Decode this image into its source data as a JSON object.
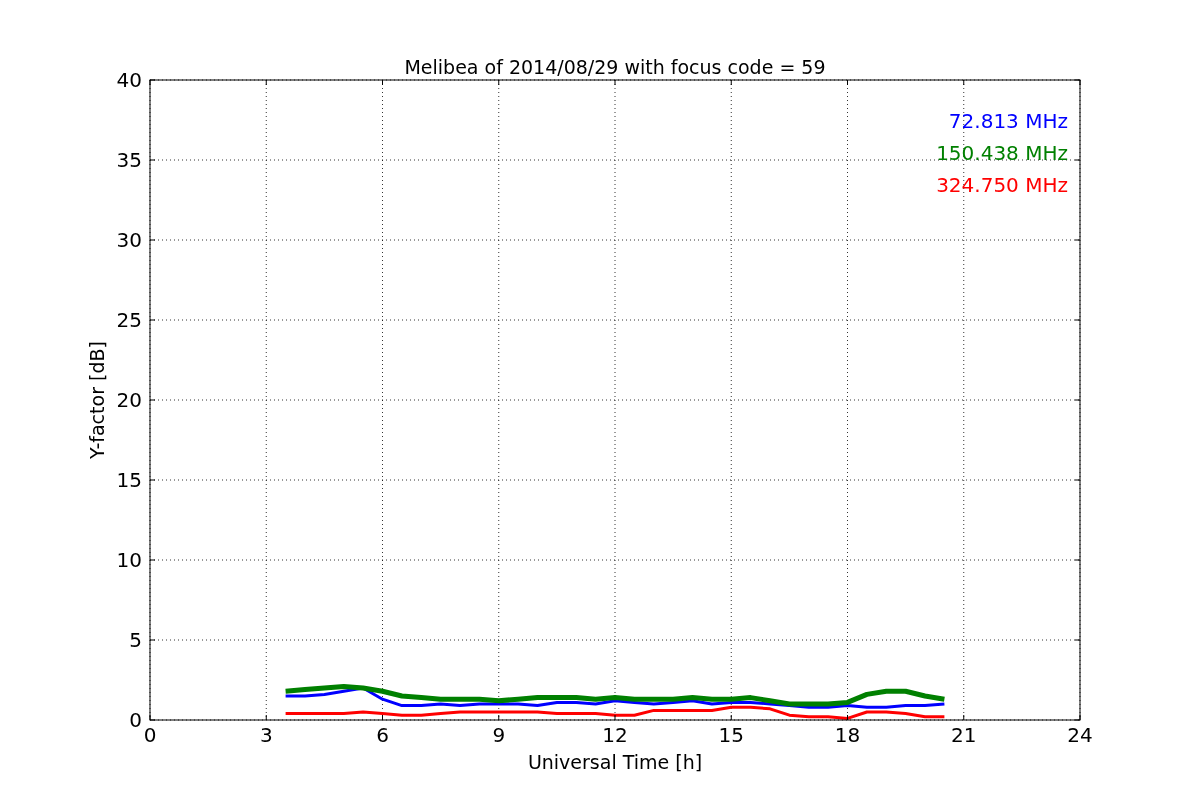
{
  "chart_data": {
    "type": "line",
    "title": "Melibea of 2014/08/29 with focus code = 59",
    "xlabel": "Universal Time [h]",
    "ylabel": "Y-factor [dB]",
    "x": [
      3.5,
      4,
      4.5,
      5,
      5.5,
      6,
      6.5,
      7,
      7.5,
      8,
      8.5,
      9,
      9.5,
      10,
      10.5,
      11,
      11.5,
      12,
      12.5,
      13,
      13.5,
      14,
      14.5,
      15,
      15.5,
      16,
      16.5,
      17,
      17.5,
      18,
      18.5,
      19,
      19.5,
      20,
      20.5
    ],
    "series": [
      {
        "name": "72.813 MHz",
        "color": "#0000ff",
        "values": [
          1.5,
          1.5,
          1.6,
          1.8,
          2.0,
          1.3,
          0.9,
          0.9,
          1.0,
          0.9,
          1.0,
          1.0,
          1.0,
          0.9,
          1.1,
          1.1,
          1.0,
          1.2,
          1.1,
          1.0,
          1.1,
          1.2,
          1.0,
          1.1,
          1.1,
          1.0,
          0.9,
          0.8,
          0.8,
          0.9,
          0.8,
          0.8,
          0.9,
          0.9,
          1.0
        ]
      },
      {
        "name": "150.438 MHz",
        "color": "#008000",
        "values": [
          1.8,
          1.9,
          2.0,
          2.1,
          2.0,
          1.8,
          1.5,
          1.4,
          1.3,
          1.3,
          1.3,
          1.2,
          1.3,
          1.4,
          1.4,
          1.4,
          1.3,
          1.4,
          1.3,
          1.3,
          1.3,
          1.4,
          1.3,
          1.3,
          1.4,
          1.2,
          1.0,
          1.0,
          1.0,
          1.1,
          1.6,
          1.8,
          1.8,
          1.5,
          1.3
        ]
      },
      {
        "name": "324.750 MHz",
        "color": "#ff0000",
        "values": [
          0.4,
          0.4,
          0.4,
          0.4,
          0.5,
          0.4,
          0.3,
          0.3,
          0.4,
          0.5,
          0.5,
          0.5,
          0.5,
          0.5,
          0.4,
          0.4,
          0.4,
          0.3,
          0.3,
          0.6,
          0.6,
          0.6,
          0.6,
          0.8,
          0.8,
          0.7,
          0.3,
          0.2,
          0.2,
          0.1,
          0.5,
          0.5,
          0.4,
          0.2,
          0.2
        ]
      }
    ],
    "xlim": [
      0,
      24
    ],
    "ylim": [
      0,
      40
    ],
    "xticks": [
      0,
      3,
      6,
      9,
      12,
      15,
      18,
      21,
      24
    ],
    "yticks": [
      0,
      5,
      10,
      15,
      20,
      25,
      30,
      35,
      40
    ],
    "grid": true
  }
}
